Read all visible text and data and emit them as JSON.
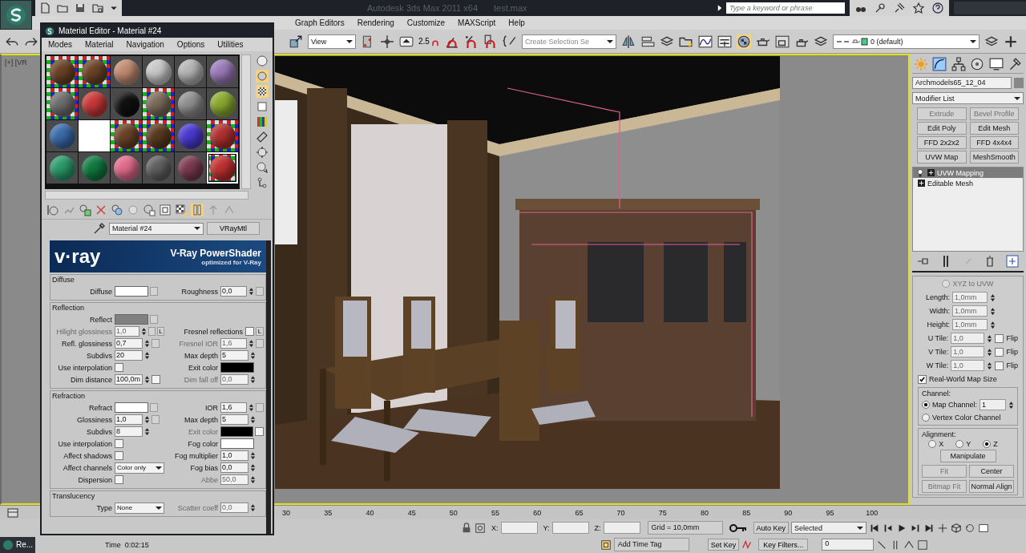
{
  "app": {
    "title": "Autodesk 3ds Max 2011 x64",
    "file": "test.max",
    "search_placeholder": "Type a keyword or phrase"
  },
  "menu": [
    "Graph Editors",
    "Rendering",
    "Customize",
    "MAXScript",
    "Help"
  ],
  "toolbar": {
    "view": "View",
    "snap": "2.5",
    "selection_set_placeholder": "Create Selection Se",
    "layer": "0 (default)"
  },
  "viewport": {
    "label": "[+] [VR"
  },
  "material_editor": {
    "title": "Material Editor - Material #24",
    "menu": [
      "Modes",
      "Material",
      "Navigation",
      "Options",
      "Utilities"
    ],
    "slots": [
      {
        "kind": "sphere",
        "color": "#6b4326",
        "backlight": true,
        "selected": false
      },
      {
        "kind": "sphere",
        "color": "#6b4326",
        "backlight": true,
        "selected": false
      },
      {
        "kind": "sphere",
        "color": "#c08a70",
        "backlight": false,
        "selected": false
      },
      {
        "kind": "sphere",
        "color": "#c8c8c8",
        "backlight": false,
        "selected": false
      },
      {
        "kind": "sphere",
        "color": "#b4b4b4",
        "backlight": false,
        "selected": false
      },
      {
        "kind": "sphere",
        "color": "#9a7ab8",
        "backlight": false,
        "selected": false
      },
      {
        "kind": "sphere",
        "color": "#6e6e6e",
        "backlight": true,
        "selected": false
      },
      {
        "kind": "sphere",
        "color": "#c83838",
        "backlight": false,
        "selected": false
      },
      {
        "kind": "sphere",
        "color": "#101010",
        "backlight": false,
        "selected": false
      },
      {
        "kind": "sphere",
        "color": "#7a6a5a",
        "backlight": true,
        "selected": false
      },
      {
        "kind": "sphere",
        "color": "#909090",
        "backlight": false,
        "selected": false
      },
      {
        "kind": "sphere",
        "color": "#8aaa30",
        "backlight": false,
        "selected": false
      },
      {
        "kind": "sphere",
        "color": "#3a6aa8",
        "backlight": false,
        "selected": false
      },
      {
        "kind": "blank",
        "color": "#ffffff",
        "backlight": false,
        "selected": false
      },
      {
        "kind": "sphere",
        "color": "#6b4326",
        "backlight": true,
        "selected": false
      },
      {
        "kind": "sphere",
        "color": "#5a3a20",
        "backlight": true,
        "selected": false
      },
      {
        "kind": "sphere",
        "color": "#4a3ad0",
        "backlight": false,
        "selected": false
      },
      {
        "kind": "sphere",
        "color": "#b03030",
        "backlight": true,
        "selected": false
      },
      {
        "kind": "sphere",
        "color": "#2a9a6a",
        "backlight": false,
        "selected": false
      },
      {
        "kind": "sphere",
        "color": "#107a40",
        "backlight": false,
        "selected": false
      },
      {
        "kind": "sphere",
        "color": "#e06a8a",
        "backlight": false,
        "selected": false
      },
      {
        "kind": "sphere",
        "color": "#606060",
        "backlight": false,
        "selected": false
      },
      {
        "kind": "sphere",
        "color": "#7a3a50",
        "backlight": false,
        "selected": false
      },
      {
        "kind": "sphere",
        "color": "#c03030",
        "backlight": true,
        "selected": true
      }
    ],
    "material_name": "Material #24",
    "material_type": "VRayMtl",
    "banner": {
      "logo": "v·ray",
      "title": "V-Ray PowerShader",
      "subtitle": "optimized for V-Ray"
    },
    "rollouts": [
      {
        "title": "Diffuse",
        "rows": [
          {
            "left": {
              "kind": "color",
              "label": "Diffuse",
              "color": "#ffffff",
              "disabled": false,
              "map": true
            },
            "right": {
              "kind": "spinner",
              "label": "Roughness",
              "value": "0,0",
              "disabled": false,
              "map": true
            }
          }
        ]
      },
      {
        "title": "Reflection",
        "rows": [
          {
            "left": {
              "kind": "color",
              "label": "Reflect",
              "color": "#808080",
              "disabled": false,
              "map": true
            }
          },
          {
            "left": {
              "kind": "spinner",
              "label": "Hilight glossiness",
              "value": "1,0",
              "disabled": true,
              "map": true,
              "button": "L"
            },
            "right": {
              "kind": "check",
              "label": "Fresnel reflections",
              "checked": false,
              "disabled": false,
              "button": "L"
            }
          },
          {
            "left": {
              "kind": "spinner",
              "label": "Refl. glossiness",
              "value": "0,7",
              "disabled": false,
              "map": true
            },
            "right": {
              "kind": "spinner",
              "label": "Fresnel IOR",
              "value": "1,6",
              "disabled": true,
              "map": true
            }
          },
          {
            "left": {
              "kind": "spinner",
              "label": "Subdivs",
              "value": "20",
              "disabled": false
            },
            "right": {
              "kind": "spinner",
              "label": "Max depth",
              "value": "5",
              "disabled": false
            }
          },
          {
            "left": {
              "kind": "check",
              "label": "Use interpolation",
              "checked": false,
              "disabled": false
            },
            "right": {
              "kind": "color",
              "label": "Exit color",
              "color": "#000000",
              "disabled": false
            }
          },
          {
            "left": {
              "kind": "spinner",
              "label": "Dim distance",
              "value": "100,0m",
              "disabled": false,
              "checked": false
            },
            "right": {
              "kind": "spinner",
              "label": "Dim fall off",
              "value": "0,0",
              "disabled": true
            }
          }
        ]
      },
      {
        "title": "Refraction",
        "rows": [
          {
            "left": {
              "kind": "color",
              "label": "Refract",
              "color": "#ffffff",
              "disabled": false,
              "map": true
            },
            "right": {
              "kind": "spinner",
              "label": "IOR",
              "value": "1,6",
              "disabled": false,
              "map": true
            }
          },
          {
            "left": {
              "kind": "spinner",
              "label": "Glossiness",
              "value": "1,0",
              "disabled": false,
              "map": true
            },
            "right": {
              "kind": "spinner",
              "label": "Max depth",
              "value": "5",
              "disabled": false
            }
          },
          {
            "left": {
              "kind": "spinner",
              "label": "Subdivs",
              "value": "8",
              "disabled": false
            },
            "right": {
              "kind": "color",
              "label": "Exit color",
              "color": "#000000",
              "disabled": true,
              "checked": false
            }
          },
          {
            "left": {
              "kind": "check",
              "label": "Use interpolation",
              "checked": false,
              "disabled": false
            },
            "right": {
              "kind": "color",
              "label": "Fog color",
              "color": "#ffffff",
              "disabled": false
            }
          },
          {
            "left": {
              "kind": "check",
              "label": "Affect shadows",
              "checked": false,
              "disabled": false
            },
            "right": {
              "kind": "spinner",
              "label": "Fog multiplier",
              "value": "1,0",
              "disabled": false
            }
          },
          {
            "left": {
              "kind": "dropdown",
              "label": "Affect channels",
              "value": "Color only",
              "disabled": false
            },
            "right": {
              "kind": "spinner",
              "label": "Fog bias",
              "value": "0,0",
              "disabled": false
            }
          },
          {
            "left": {
              "kind": "check",
              "label": "Dispersion",
              "checked": false,
              "disabled": false
            },
            "right": {
              "kind": "spinner",
              "label": "Abbe",
              "value": "50,0",
              "disabled": true
            }
          }
        ]
      },
      {
        "title": "Translucency",
        "rows": [
          {
            "left": {
              "kind": "dropdown",
              "label": "Type",
              "value": "None",
              "disabled": false
            },
            "right": {
              "kind": "spinner",
              "label": "Scatter coeff",
              "value": "0,0",
              "disabled": true
            }
          }
        ]
      }
    ]
  },
  "command_panel": {
    "object_name": "Archmodels65_12_04",
    "modifier_list": "Modifier List",
    "modifier_buttons": [
      {
        "label": "Extrude",
        "disabled": true
      },
      {
        "label": "Bevel Profile",
        "disabled": true
      },
      {
        "label": "Edit Poly",
        "disabled": false
      },
      {
        "label": "Edit Mesh",
        "disabled": false
      },
      {
        "label": "FFD 2x2x2",
        "disabled": false
      },
      {
        "label": "FFD 4x4x4",
        "disabled": false
      },
      {
        "label": "UVW Map",
        "disabled": false
      },
      {
        "label": "MeshSmooth",
        "disabled": false
      }
    ],
    "stack": [
      {
        "label": "UVW Mapping",
        "selected": true,
        "light_on": true
      },
      {
        "label": "Editable Mesh",
        "selected": false,
        "light_on": false
      }
    ],
    "xyz_to_uvw": {
      "label": "XYZ to UVW",
      "disabled": true
    },
    "dims": [
      {
        "label": "Length:",
        "value": "1,0mm"
      },
      {
        "label": "Width:",
        "value": "1,0mm"
      },
      {
        "label": "Height:",
        "value": "1,0mm"
      }
    ],
    "tiles": [
      {
        "label": "U Tile:",
        "value": "1,0",
        "flip_label": "Flip",
        "flip": false
      },
      {
        "label": "V Tile:",
        "value": "1,0",
        "flip_label": "Flip",
        "flip": false
      },
      {
        "label": "W Tile:",
        "value": "1,0",
        "flip_label": "Flip",
        "flip": false
      }
    ],
    "real_world": {
      "label": "Real-World Map Size",
      "checked": true
    },
    "channel": {
      "title": "Channel:",
      "map_channel": "1",
      "options": [
        {
          "label": "Map Channel:",
          "selected": true
        },
        {
          "label": "Vertex Color Channel",
          "selected": false
        }
      ]
    },
    "alignment": {
      "title": "Alignment:",
      "axes": [
        {
          "label": "X",
          "selected": false
        },
        {
          "label": "Y",
          "selected": false
        },
        {
          "label": "Z",
          "selected": true
        }
      ],
      "buttons": [
        {
          "label": "Manipulate",
          "disabled": false
        },
        {
          "label": "Fit",
          "disabled": true
        },
        {
          "label": "Center",
          "disabled": false
        },
        {
          "label": "Bitmap Fit",
          "disabled": true
        },
        {
          "label": "Normal Align",
          "disabled": false
        }
      ]
    }
  },
  "timeline": [
    "30",
    "35",
    "40",
    "45",
    "50",
    "55",
    "60",
    "65",
    "70",
    "75",
    "80",
    "85",
    "90",
    "95",
    "100"
  ],
  "status": {
    "x_label": "X:",
    "y_label": "Y:",
    "z_label": "Z:",
    "grid": "Grid = 10,0mm",
    "auto_key": "Auto Key",
    "selection": "Selected",
    "set_key": "Set Key",
    "key_filters": "Key Filters...",
    "frame": "0",
    "time": "Time  0:02:15",
    "add_time_tag": "Add Time Tag",
    "taskbar_item": "Re..."
  }
}
